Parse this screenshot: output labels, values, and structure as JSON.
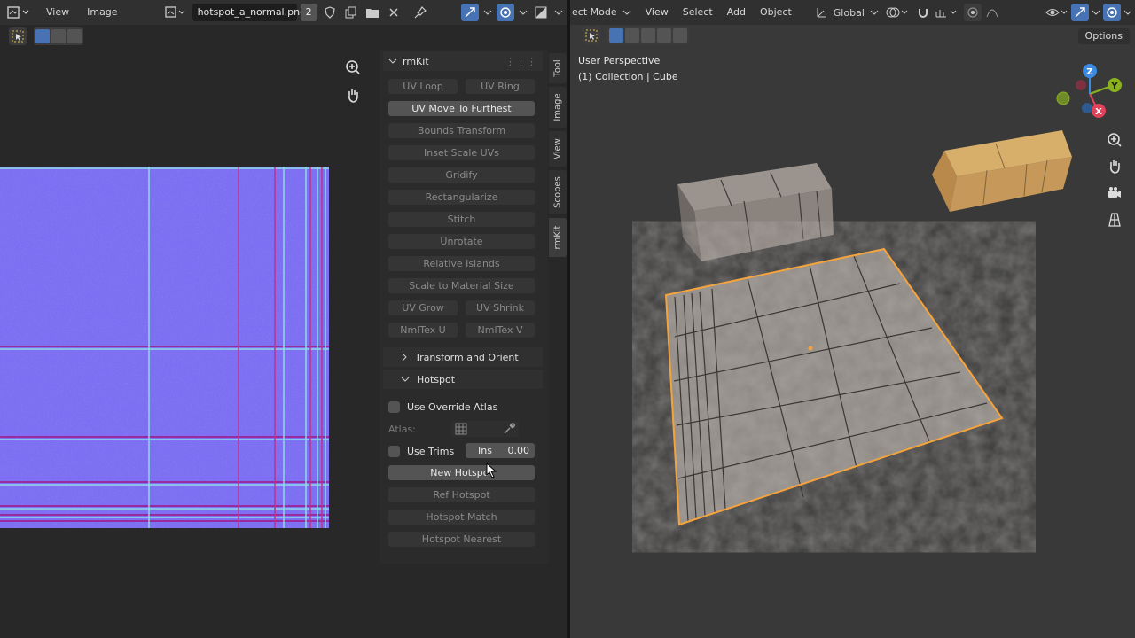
{
  "uv_editor": {
    "menus": [
      "View",
      "Image"
    ],
    "image_name": "hotspot_a_normal.png",
    "user_count": "2"
  },
  "rmkit": {
    "title": "rmKit",
    "buttons": {
      "uv_loop": "UV Loop",
      "uv_ring": "UV Ring",
      "uv_move_to_furthest": "UV Move To Furthest",
      "bounds_transform": "Bounds Transform",
      "inset_scale_uvs": "Inset Scale UVs",
      "gridify": "Gridify",
      "rectangularize": "Rectangularize",
      "stitch": "Stitch",
      "unrotate": "Unrotate",
      "relative_islands": "Relative Islands",
      "scale_to_material_size": "Scale to Material Size",
      "uv_grow": "UV Grow",
      "uv_shrink": "UV Shrink",
      "nmltex_u": "NmlTex U",
      "nmltex_v": "NmlTex V"
    },
    "subpanels": {
      "transform_and_orient": "Transform and Orient",
      "hotspot": "Hotspot"
    },
    "hotspot": {
      "use_override_atlas": "Use Override Atlas",
      "atlas_label": "Atlas:",
      "use_trims": "Use Trims",
      "ins_label": "Ins",
      "ins_value": "0.00",
      "new_hotspot": "New Hotspot",
      "ref_hotspot": "Ref Hotspot",
      "hotspot_match": "Hotspot Match",
      "hotspot_nearest": "Hotspot Nearest"
    }
  },
  "sidebar_tabs": [
    "Tool",
    "Image",
    "View",
    "Scopes",
    "rmKit"
  ],
  "sidebar_active_tab": "rmKit",
  "viewport": {
    "mode": "ect Mode",
    "menus": [
      "View",
      "Select",
      "Add",
      "Object"
    ],
    "transform_orientation": "Global",
    "options": "Options",
    "view_name": "User Perspective",
    "collection_info": "(1) Collection | Cube"
  },
  "gizmo": {
    "axes": [
      "X",
      "Y",
      "Z"
    ],
    "colors": {
      "x": "#e0435a",
      "y": "#8ab21f",
      "z": "#3b8be3"
    }
  },
  "colors": {
    "accent": "#4772b3",
    "selection_outline": "#f5a33c",
    "uv_normal_map": "#7b6cf0"
  }
}
